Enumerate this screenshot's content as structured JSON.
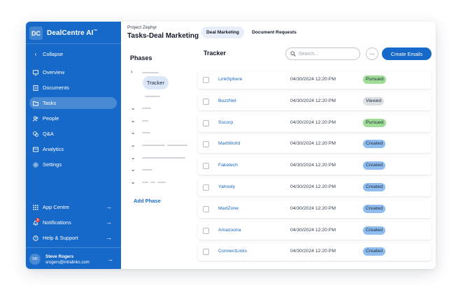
{
  "app": {
    "logo": "DC",
    "name": "DealCentre AI",
    "trademark": "™"
  },
  "nav": {
    "collapse": "Collapse",
    "items": [
      {
        "label": "Overview",
        "icon": "monitor-icon"
      },
      {
        "label": "Documents",
        "icon": "document-icon"
      },
      {
        "label": "Tasks",
        "icon": "folder-icon"
      },
      {
        "label": "People",
        "icon": "people-icon"
      },
      {
        "label": "Q&A",
        "icon": "chat-icon"
      },
      {
        "label": "Analytics",
        "icon": "analytics-icon"
      },
      {
        "label": "Settings",
        "icon": "gear-icon"
      }
    ],
    "bottom": [
      {
        "label": "App Centre",
        "icon": "grid-icon"
      },
      {
        "label": "Notifications",
        "icon": "bell-icon",
        "badge": "2"
      },
      {
        "label": "Help & Support",
        "icon": "help-icon"
      }
    ],
    "active": "Tasks"
  },
  "user": {
    "initials": "SR",
    "name": "Steve Rogers",
    "email": "srogers@intralinks.com"
  },
  "header": {
    "project": "Project Zephyr",
    "title": "Tasks-Deal Marketing",
    "tabs": [
      {
        "label": "Deal Marketing",
        "active": true
      },
      {
        "label": "Document Requests",
        "active": false
      }
    ]
  },
  "phases": {
    "title": "Phases",
    "selected": "Tracker",
    "add_label": "Add Phase"
  },
  "tracker": {
    "title": "Tracker",
    "search_placeholder": "Search...",
    "more_label": "···",
    "create_label": "Create Emails",
    "rows": [
      {
        "name": "LinkSphere",
        "date": "04/30/2024 12:20 PM",
        "status": "Pursued"
      },
      {
        "name": "BuzzNet",
        "date": "04/30/2024 12:20 PM",
        "status": "Viewed"
      },
      {
        "name": "Sscorp",
        "date": "04/30/2024 12:20 PM",
        "status": "Pursued"
      },
      {
        "name": "MartWorld",
        "date": "04/30/2024 12:20 PM",
        "status": "Created"
      },
      {
        "name": "Faketech",
        "date": "04/30/2024 12:20 PM",
        "status": "Created"
      },
      {
        "name": "Yahooly",
        "date": "04/30/2024 12:20 PM",
        "status": "Created"
      },
      {
        "name": "MartZone",
        "date": "04/30/2024 12:20 PM",
        "status": "Created"
      },
      {
        "name": "Amazoona",
        "date": "04/30/2024 12:20 PM",
        "status": "Created"
      },
      {
        "name": "ConnectLinks",
        "date": "04/30/2024 12:20 PM",
        "status": "Created"
      }
    ]
  },
  "colors": {
    "sidebar": "#1769c9",
    "accent": "#1769c9",
    "status_pursued": "#9fdc95",
    "status_viewed": "#dde0e5",
    "status_created": "#8fbdf0"
  }
}
